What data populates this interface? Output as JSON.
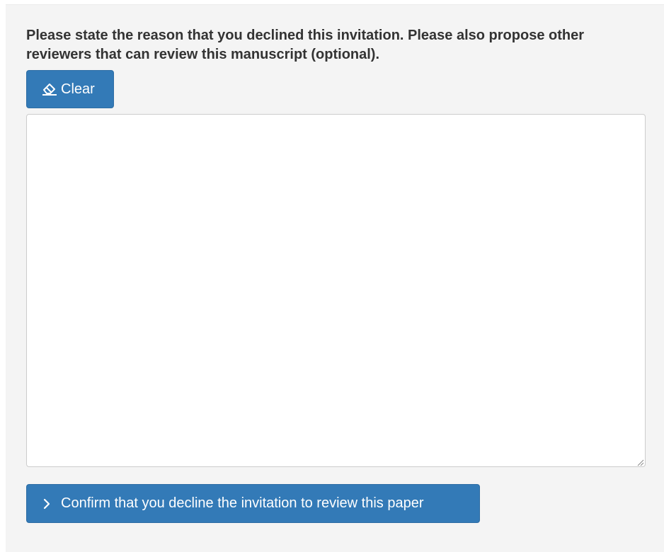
{
  "form": {
    "prompt_text": "Please state the reason that you declined this invitation. Please also propose other reviewers that can review this manuscript (optional).",
    "clear_button": {
      "label": "Clear",
      "icon": "eraser-icon"
    },
    "reason_textarea": {
      "value": "",
      "placeholder": ""
    },
    "confirm_button": {
      "label": "Confirm that you decline the invitation to review this paper",
      "icon": "chevron-right-icon"
    }
  },
  "colors": {
    "primary": "#337ab7",
    "panel_background": "#f4f4f4",
    "text": "#333333"
  }
}
